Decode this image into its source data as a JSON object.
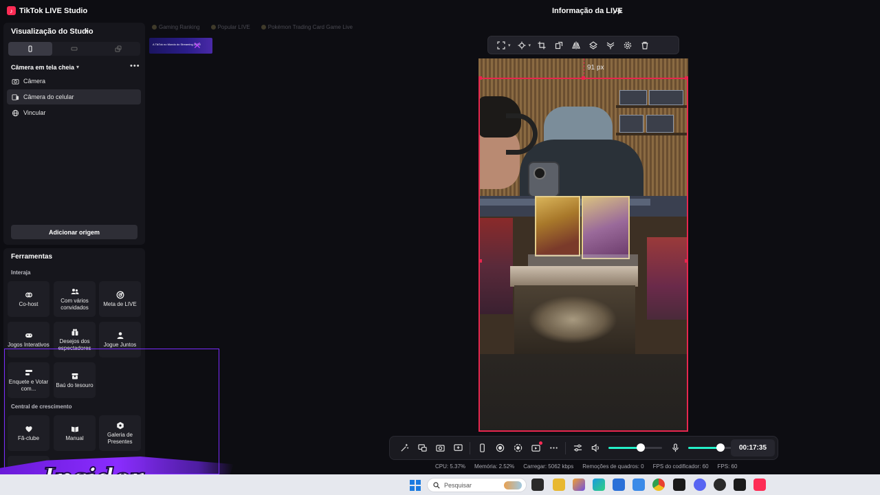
{
  "app": {
    "title": "TikTok LIVE Studio",
    "live_info": "Informação da LIVE"
  },
  "studio": {
    "title": "Visualização do Studio",
    "scene": "Câmera em tela cheia",
    "sources": [
      {
        "label": "Câmera",
        "icon": "camera-icon"
      },
      {
        "label": "Câmera do celular",
        "icon": "phone-camera-icon"
      },
      {
        "label": "Vincular",
        "icon": "globe-icon"
      }
    ],
    "add_source": "Adicionar origem"
  },
  "tools": {
    "title": "Ferramentas",
    "interact_label": "Interaja",
    "interact": [
      {
        "label": "Co-host",
        "icon": "link-icon"
      },
      {
        "label": "Com vários convidados",
        "icon": "people-icon"
      },
      {
        "label": "Meta de LIVE",
        "icon": "target-icon"
      },
      {
        "label": "Jogos Interativos",
        "icon": "gamepad-icon"
      },
      {
        "label": "Desejos dos espectadores",
        "icon": "gift-icon"
      },
      {
        "label": "Jogue Juntos",
        "icon": "user-play-icon"
      },
      {
        "label": "Enquete e Votar com...",
        "icon": "poll-icon"
      },
      {
        "label": "Baú do tesouro",
        "icon": "chest-icon"
      }
    ],
    "growth_label": "Central de crescimento",
    "growth": [
      {
        "label": "Fã-clube",
        "icon": "heart-icon"
      },
      {
        "label": "Manual",
        "icon": "book-icon"
      },
      {
        "label": "Galeria de Presentes",
        "icon": "gallery-icon"
      }
    ]
  },
  "scene_tabs": [
    "Gaming Ranking",
    "Popular LIVE",
    "Pokémon Trading Card Game Live"
  ],
  "thumbnail": {
    "text": "A TikTok no Mundo do Streaming 2025!"
  },
  "preview": {
    "offset_label": "91 px"
  },
  "controls": {
    "timer": "00:17:35",
    "volume": 0.6,
    "mic": 0.6
  },
  "stats": {
    "cpu": "CPU: 5.37%",
    "memory": "Memória: 2.52%",
    "upload": "Carregar: 5062 kbps",
    "dropped": "Remoções de quadros: 0",
    "encoder_fps": "FPS do codificador: 60",
    "fps": "FPS: 60"
  },
  "overlay": {
    "brand": "Insider"
  },
  "taskbar": {
    "search_placeholder": "Pesquisar"
  },
  "colors": {
    "accent": "#fe2c55",
    "teal": "#25f0c8",
    "overlay_purple": "#7a2cff"
  }
}
